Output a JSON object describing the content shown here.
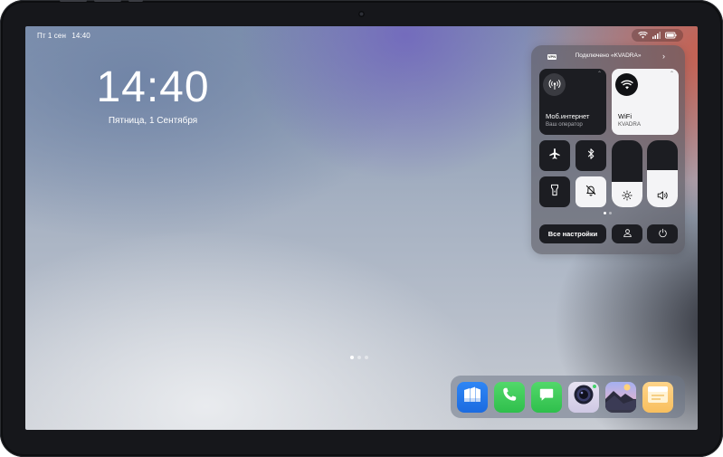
{
  "status_bar": {
    "day": "Пт 1 сен",
    "time": "14:40",
    "icons": [
      "wifi-icon",
      "signal-icon",
      "battery-icon"
    ]
  },
  "lock_screen": {
    "time": "14:40",
    "date": "Пятница, 1 Сентября"
  },
  "home_pages": {
    "count": 3,
    "active_index": 0
  },
  "control_center": {
    "header": {
      "vpn_badge": "VPN",
      "text": "Подключено «KVADRA»",
      "chevron": "›"
    },
    "mobile_internet": {
      "title": "Моб.интернет",
      "subtitle": "Ваш оператор",
      "icon": "antenna-icon",
      "enabled": false
    },
    "wifi": {
      "title": "WiFi",
      "subtitle": "KVADRA",
      "icon": "wifi-icon",
      "enabled": true
    },
    "toggles": {
      "airplane": {
        "icon": "airplane-icon",
        "enabled": false
      },
      "bluetooth": {
        "icon": "bluetooth-icon",
        "enabled": false
      },
      "flashlight": {
        "icon": "flashlight-icon",
        "enabled": false
      },
      "do_not_disturb": {
        "icon": "bell-off-icon",
        "enabled": true
      }
    },
    "brightness": {
      "icon": "sun-icon",
      "level": 0.38
    },
    "volume": {
      "icon": "speaker-icon",
      "level": 0.55
    },
    "pager": {
      "count": 2,
      "active_index": 0
    },
    "all_settings_label": "Все настройки",
    "user_icon": "user-icon",
    "power_icon": "power-icon"
  },
  "dock": {
    "apps": [
      {
        "name": "files",
        "icon": "files-icon"
      },
      {
        "name": "phone",
        "icon": "phone-icon"
      },
      {
        "name": "messages",
        "icon": "messages-icon"
      },
      {
        "name": "camera",
        "icon": "camera-icon"
      },
      {
        "name": "gallery",
        "icon": "gallery-icon"
      },
      {
        "name": "notes",
        "icon": "notes-icon"
      }
    ]
  }
}
